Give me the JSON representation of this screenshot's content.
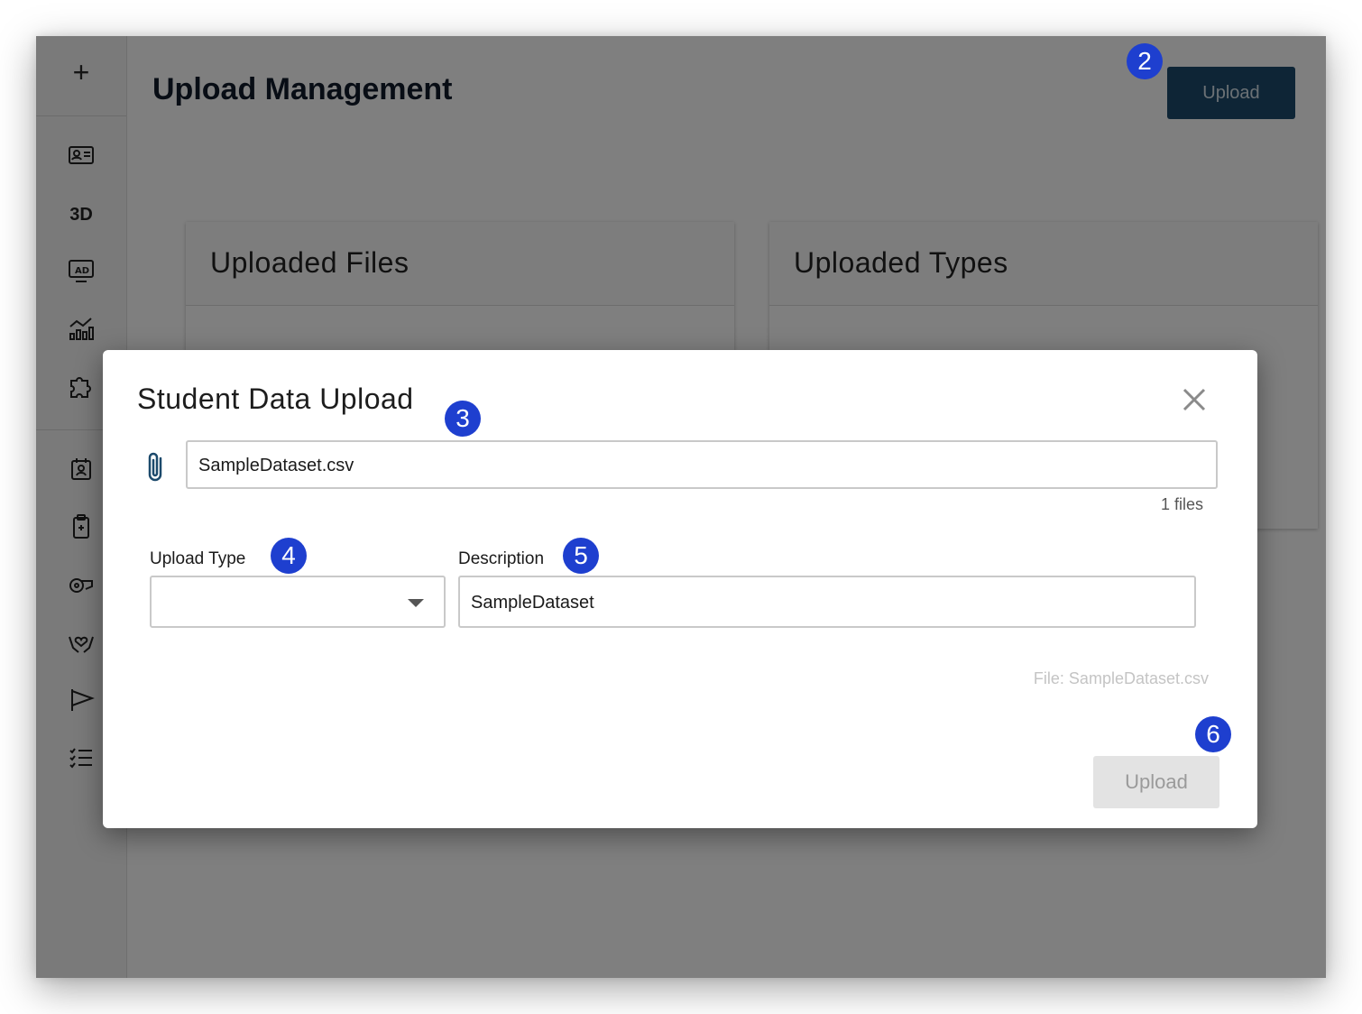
{
  "sidebar": {
    "add_icon": "+",
    "three_d_label": "3D",
    "icons": [
      "id-card-icon",
      "3d-icon",
      "ad-monitor-icon",
      "chart-icon",
      "puzzle-icon",
      "calendar-person-icon",
      "clipboard-icon",
      "whistle-icon",
      "hands-heart-icon",
      "flag-icon",
      "checklist-icon"
    ]
  },
  "header": {
    "title": "Upload Management",
    "upload_label": "Upload"
  },
  "cards": [
    {
      "title": "Uploaded Files"
    },
    {
      "title": "Uploaded Types"
    }
  ],
  "badges": {
    "b2": "2",
    "b3": "3",
    "b4": "4",
    "b5": "5",
    "b6": "6"
  },
  "modal": {
    "title": "Student Data Upload",
    "file_value": "SampleDataset.csv",
    "files_count": "1 files",
    "upload_type_label": "Upload Type",
    "upload_type_value": "",
    "description_label": "Description",
    "description_value": "SampleDataset",
    "file_note": "File: SampleDataset.csv",
    "upload_label": "Upload"
  },
  "colors": {
    "primary": "#1c4a6c",
    "badge": "#1e3fcf",
    "disabled": "#e3e3e3"
  }
}
